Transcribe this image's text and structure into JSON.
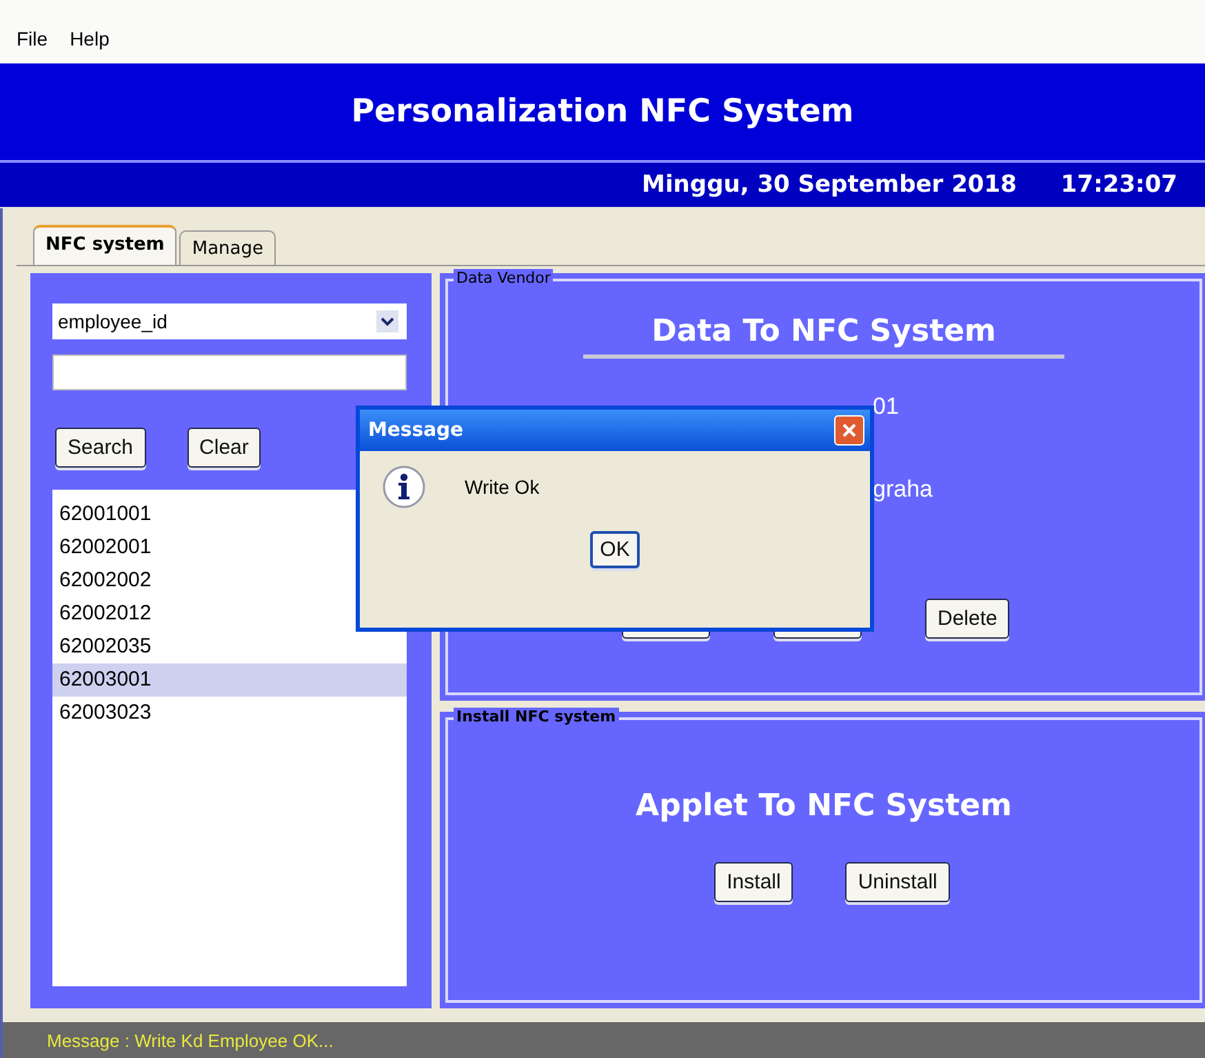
{
  "menu": [
    {
      "label": "File"
    },
    {
      "label": "Help"
    }
  ],
  "header": {
    "title": "Personalization NFC System",
    "date": "Minggu, 30 September 2018",
    "time": "17:23:07"
  },
  "tabs": [
    {
      "label": "NFC system",
      "selected": true
    },
    {
      "label": "Manage",
      "selected": false
    }
  ],
  "search_panel": {
    "field_selector": {
      "value": "employee_id"
    },
    "buttons": [
      "Search",
      "Clear"
    ],
    "results": [
      {
        "label": "62001001",
        "selected": false
      },
      {
        "label": "62002001",
        "selected": false
      },
      {
        "label": "62002002",
        "selected": false
      },
      {
        "label": "62002012",
        "selected": false
      },
      {
        "label": "62002035",
        "selected": false
      },
      {
        "label": "62003001",
        "selected": true
      },
      {
        "label": "62003023",
        "selected": false
      }
    ]
  },
  "data_vendor": {
    "legend": "Data Vendor",
    "title": "Data To NFC System",
    "fields": [
      "01",
      "graha"
    ],
    "buttons": [
      {
        "kind": "covered"
      },
      {
        "kind": "covered"
      },
      {
        "kind": "labeled",
        "label": "Delete"
      }
    ]
  },
  "install_panel": {
    "legend": "Install NFC system",
    "title": "Applet To NFC System",
    "buttons": [
      "Install",
      "Uninstall"
    ]
  },
  "dialog": {
    "title": "Message",
    "message": "Write Ok",
    "button": "OK"
  },
  "status_bar": {
    "text": "Message : Write Kd Employee OK..."
  }
}
